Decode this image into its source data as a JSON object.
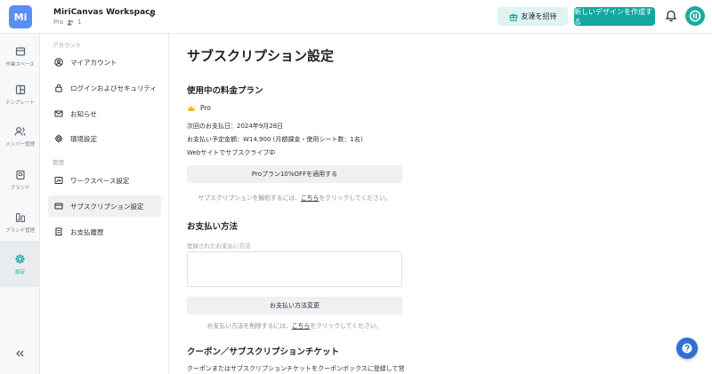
{
  "workspace": {
    "avatar_text": "Mi",
    "name": "MiriCanvas Workspace",
    "plan": "Pro",
    "member_count": "1",
    "avatar_color": "#5a8ef0"
  },
  "header": {
    "invite_label": "友達を招待",
    "create_label": "新しいデザインを作成する",
    "accent_color": "#13a7a0"
  },
  "rail": {
    "items": [
      {
        "label": "作業スペース",
        "icon": "folder-icon"
      },
      {
        "label": "テンプレート",
        "icon": "template-icon"
      },
      {
        "label": "メンバー管理",
        "icon": "users-icon"
      },
      {
        "label": "ブランド",
        "icon": "brand-icon"
      },
      {
        "label": "ブランド管理",
        "icon": "brand-manage-icon"
      },
      {
        "label": "設定",
        "icon": "gear-icon",
        "active": true
      }
    ]
  },
  "settings_nav": {
    "account_section": "アカウント",
    "account_items": [
      {
        "label": "マイアカウント",
        "icon": "user-circle-icon"
      },
      {
        "label": "ログインおよびセキュリティ",
        "icon": "lock-icon"
      },
      {
        "label": "お知らせ",
        "icon": "mail-icon"
      },
      {
        "label": "環境設定",
        "icon": "gear-icon"
      }
    ],
    "manage_section": "管理",
    "manage_items": [
      {
        "label": "ワークスペース設定",
        "icon": "workspace-icon"
      },
      {
        "label": "サブスクリプション設定",
        "icon": "card-icon",
        "active": true
      },
      {
        "label": "お支払履歴",
        "icon": "receipt-icon"
      }
    ]
  },
  "main": {
    "title": "サブスクリプション設定",
    "current_plan_heading": "使用中の料金プラン",
    "plan_name": "Pro",
    "next_payment": "次回のお支払日：2024年9月28日",
    "expected_amount": "お支払い予定金額：W14,900 (月額課金・使用シート数：1名)",
    "web_subscription": "Webサイトでサブスクライブ中",
    "discount_button": "Proプラン10%OFFを適用する",
    "cancel_note_before": "サブスクリプションを解約するには、",
    "cancel_note_link": "こちら",
    "cancel_note_after": "をクリックしてください。",
    "payment_heading": "お支払い方法",
    "registered_label": "登録されたお支払い方法",
    "change_payment_button": "お支払い方法変更",
    "delete_note_before": "お支払い方法を削除するには、",
    "delete_note_link": "こちら",
    "delete_note_after": "をクリックしてください。",
    "coupon_heading": "クーポン／サブスクリプションチケット",
    "coupon_text": "クーポンまたはサブスクリプションチケットをクーポンボックスに登録して営"
  }
}
